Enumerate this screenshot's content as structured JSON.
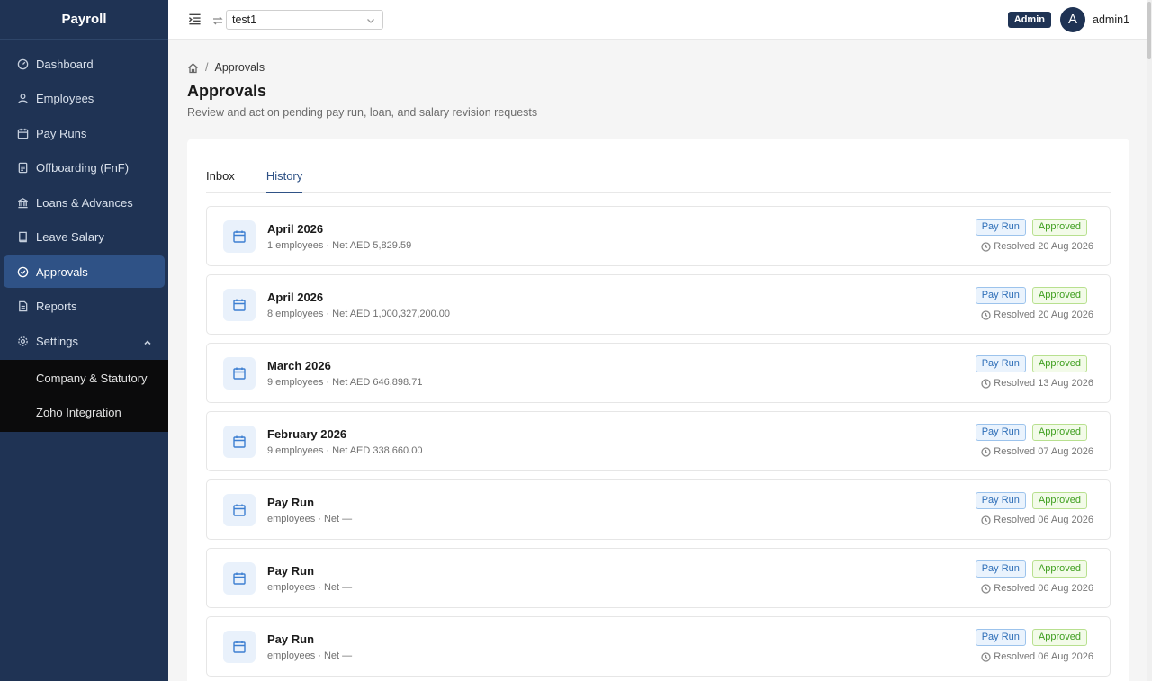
{
  "app": {
    "title": "Payroll"
  },
  "sidebar": {
    "items": [
      {
        "label": "Dashboard",
        "icon": "dashboard-icon"
      },
      {
        "label": "Employees",
        "icon": "user-icon"
      },
      {
        "label": "Pay Runs",
        "icon": "calendar-icon"
      },
      {
        "label": "Offboarding (FnF)",
        "icon": "document-icon"
      },
      {
        "label": "Loans & Advances",
        "icon": "bank-icon"
      },
      {
        "label": "Leave Salary",
        "icon": "book-icon"
      },
      {
        "label": "Approvals",
        "icon": "check-circle-icon",
        "active": true
      },
      {
        "label": "Reports",
        "icon": "report-icon"
      },
      {
        "label": "Settings",
        "icon": "gear-icon",
        "expanded": true
      }
    ],
    "settings_sub": [
      {
        "label": "Company & Statutory"
      },
      {
        "label": "Zoho Integration"
      }
    ]
  },
  "header": {
    "org_value": "test1",
    "role_badge": "Admin",
    "avatar_initial": "A",
    "username": "admin1"
  },
  "breadcrumb": {
    "current": "Approvals",
    "separator": "/"
  },
  "page": {
    "title": "Approvals",
    "subtitle": "Review and act on pending pay run, loan, and salary revision requests"
  },
  "tabs": [
    {
      "label": "Inbox",
      "active": false
    },
    {
      "label": "History",
      "active": true
    }
  ],
  "history": [
    {
      "title": "April 2026",
      "meta": "1 employees · Net AED 5,829.59",
      "type": "Pay Run",
      "status": "Approved",
      "resolved": "Resolved 20 Aug 2026"
    },
    {
      "title": "April 2026",
      "meta": "8 employees · Net AED 1,000,327,200.00",
      "type": "Pay Run",
      "status": "Approved",
      "resolved": "Resolved 20 Aug 2026"
    },
    {
      "title": "March 2026",
      "meta": "9 employees · Net AED 646,898.71",
      "type": "Pay Run",
      "status": "Approved",
      "resolved": "Resolved 13 Aug 2026"
    },
    {
      "title": "February 2026",
      "meta": "9 employees · Net AED 338,660.00",
      "type": "Pay Run",
      "status": "Approved",
      "resolved": "Resolved 07 Aug 2026"
    },
    {
      "title": "Pay Run",
      "meta": "employees · Net —",
      "type": "Pay Run",
      "status": "Approved",
      "resolved": "Resolved 06 Aug 2026"
    },
    {
      "title": "Pay Run",
      "meta": "employees · Net —",
      "type": "Pay Run",
      "status": "Approved",
      "resolved": "Resolved 06 Aug 2026"
    },
    {
      "title": "Pay Run",
      "meta": "employees · Net —",
      "type": "Pay Run",
      "status": "Approved",
      "resolved": "Resolved 06 Aug 2026"
    }
  ],
  "colors": {
    "sidebar_bg": "#1f3354",
    "active_item": "#2f5286",
    "tag_blue": "#2f6fb8",
    "tag_green": "#3f9f1f"
  }
}
